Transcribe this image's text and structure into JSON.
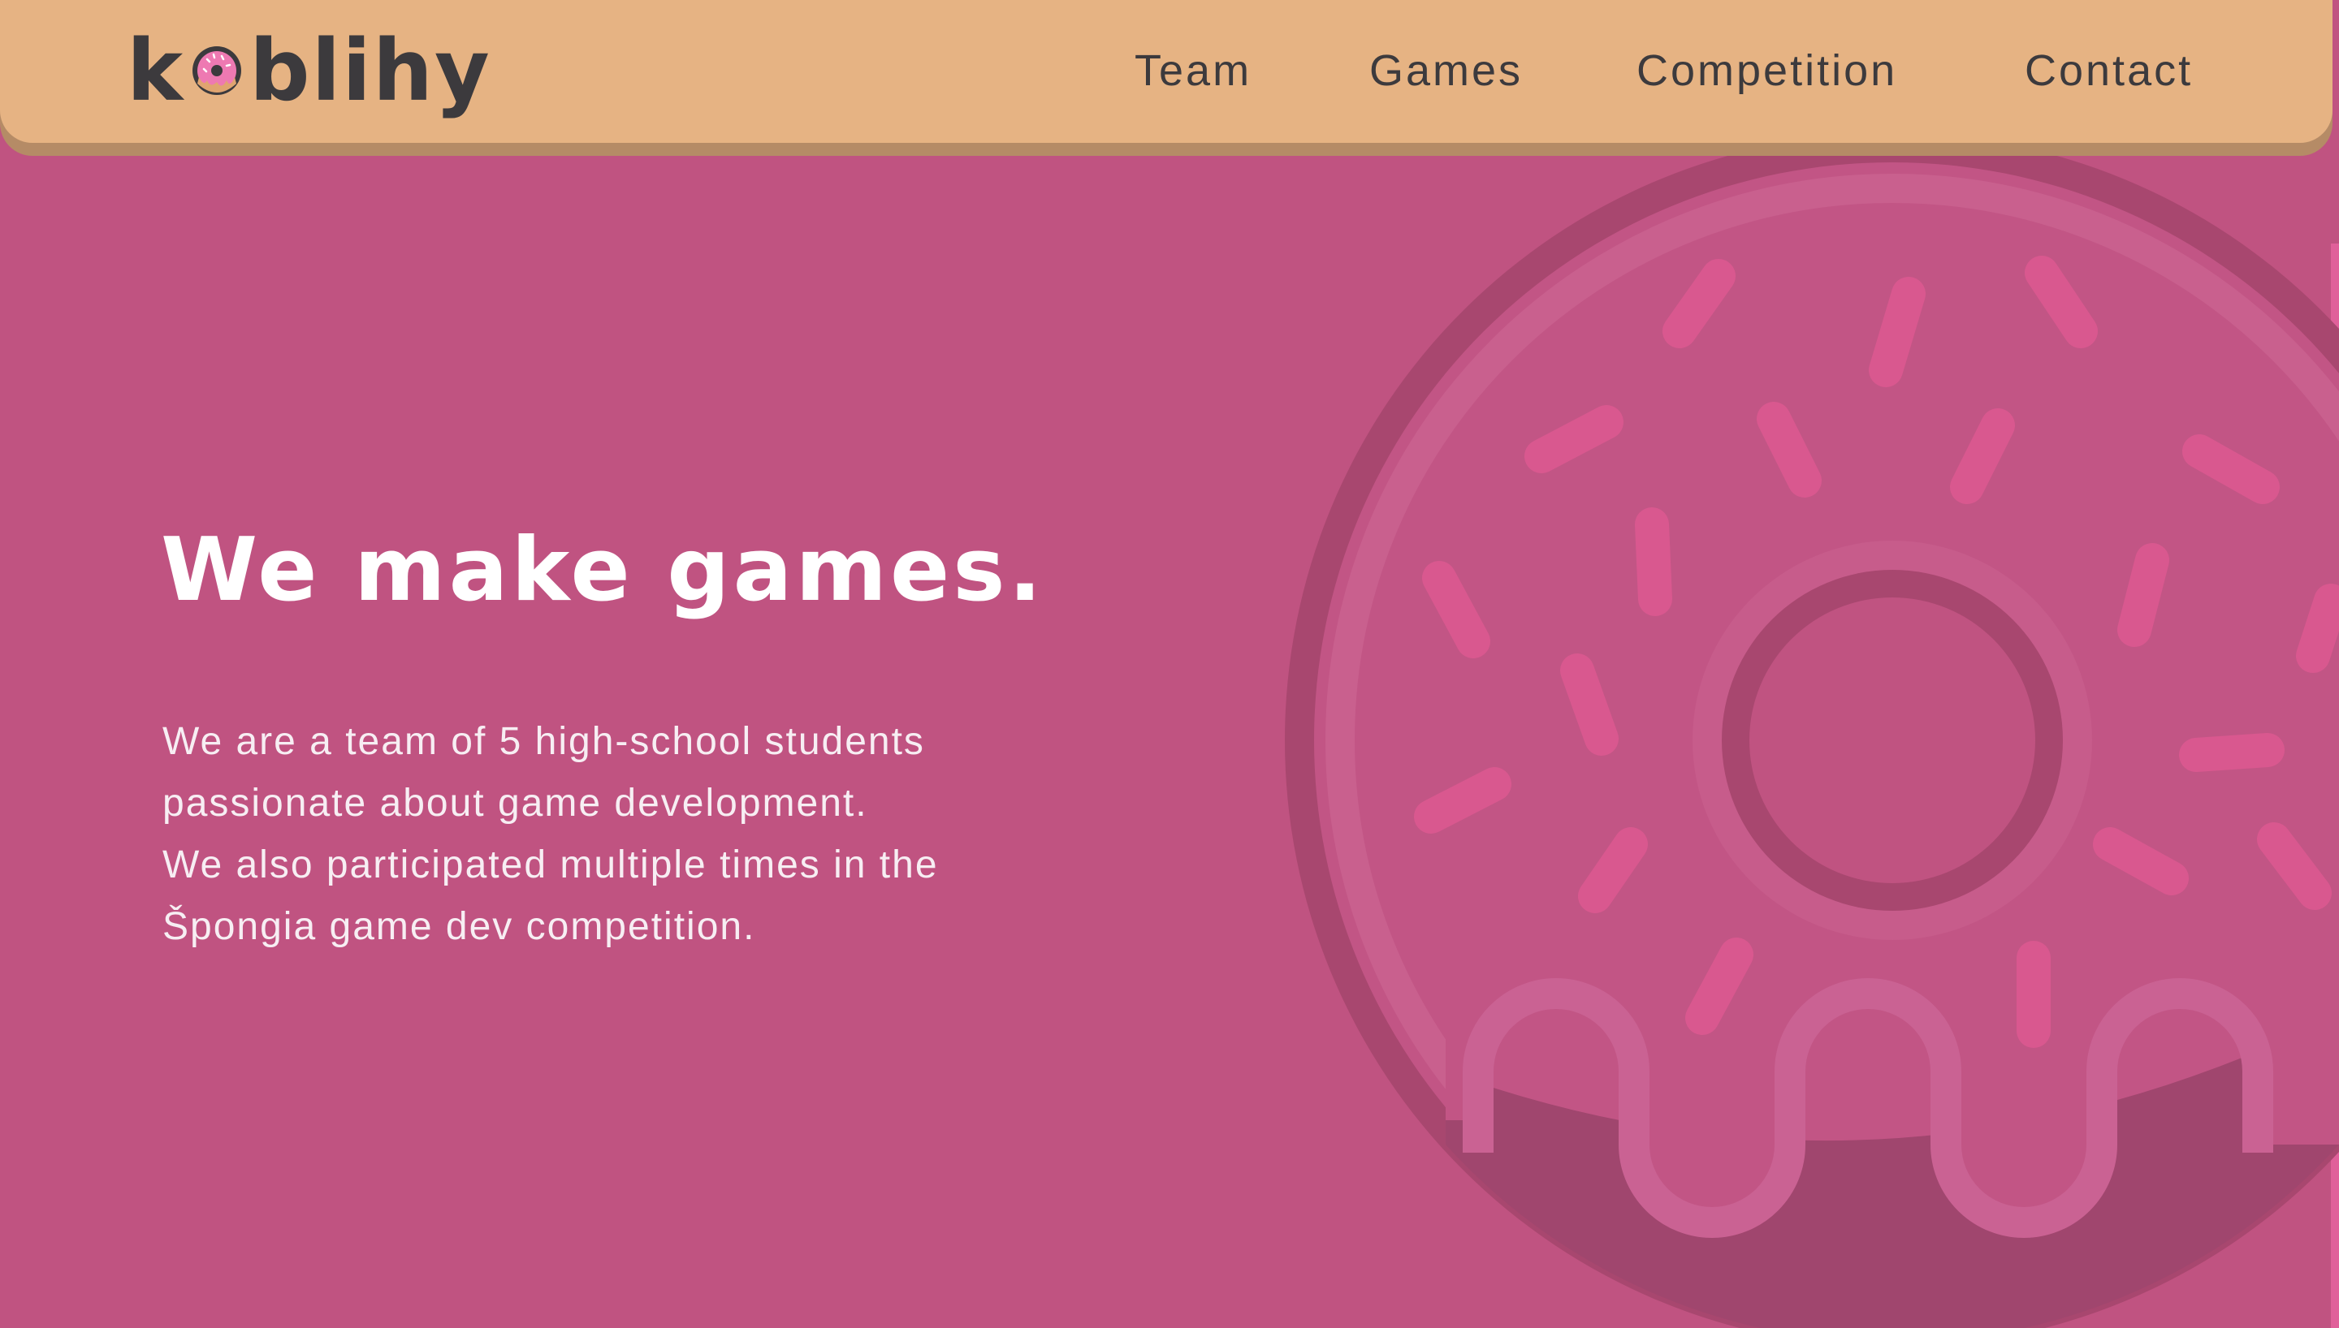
{
  "header": {
    "logo_text_prefix": "k",
    "logo_text_suffix": "blihy",
    "nav": [
      {
        "label": "Team"
      },
      {
        "label": "Games"
      },
      {
        "label": "Competition"
      },
      {
        "label": "Contact"
      }
    ]
  },
  "hero": {
    "headline": "We make games.",
    "lines": [
      "We are a team of 5 high-school students",
      "passionate about game development.",
      "We also participated multiple times in the",
      "Špongia game dev competition."
    ]
  },
  "colors": {
    "background": "#c05381",
    "header": "#e6b383",
    "header_shadow": "#b58b66",
    "text_dark": "#3c3a3d",
    "sprinkle": "#d9588f"
  },
  "icons": {
    "logo_o": "donut-icon",
    "background_illustration": "donut-illustration"
  }
}
